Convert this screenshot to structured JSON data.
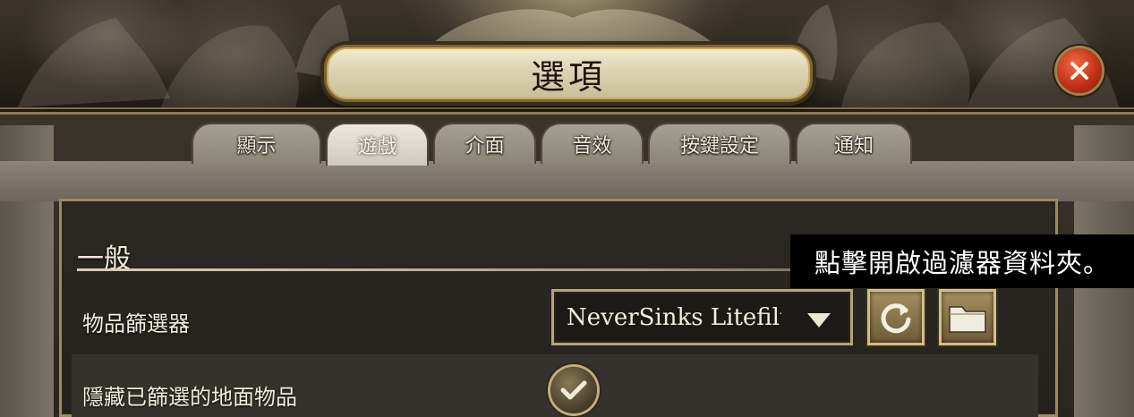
{
  "window": {
    "title": "選項"
  },
  "tabs": [
    {
      "label": "顯示",
      "active": false
    },
    {
      "label": "遊戲",
      "active": true
    },
    {
      "label": "介面",
      "active": false
    },
    {
      "label": "音效",
      "active": false
    },
    {
      "label": "按鍵設定",
      "active": false
    },
    {
      "label": "通知",
      "active": false
    }
  ],
  "section": {
    "title": "一般"
  },
  "settings": {
    "item_filter": {
      "label": "物品篩選器",
      "selected_value": "NeverSinks Litefilter",
      "reload_icon": "reload-icon",
      "folder_icon": "folder-icon"
    },
    "hide_filtered_ground_items": {
      "label": "隱藏已篩選的地面物品",
      "checked": true
    }
  },
  "tooltip": {
    "text": "點擊開啟過濾器資料夾。"
  },
  "icons": {
    "close": "close-icon",
    "dropdown_arrow": "chevron-down-icon",
    "checkmark": "checkmark-icon"
  },
  "colors": {
    "close_button": "#c23218",
    "frame_gold": "#b4a47a",
    "panel_bg": "#24211d"
  }
}
